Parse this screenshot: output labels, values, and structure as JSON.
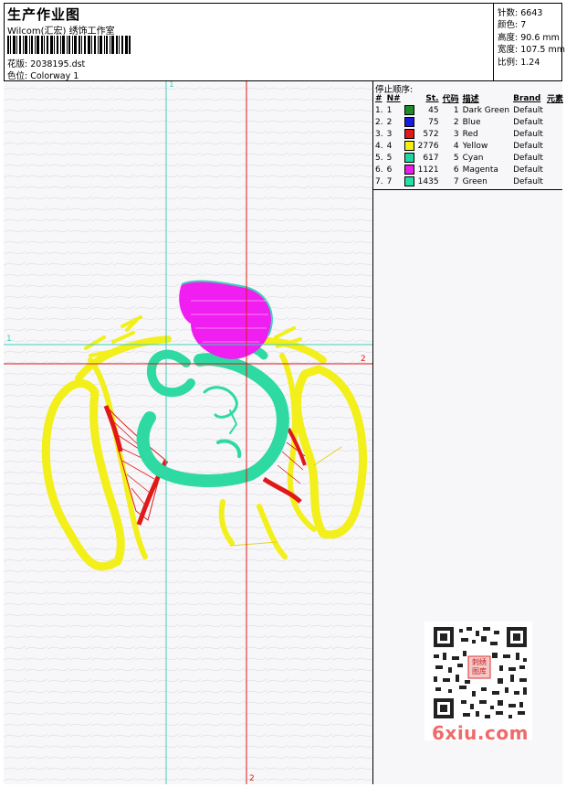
{
  "header": {
    "title": "生产作业图",
    "subtitle": "Wilcom(汇宏) 绣饰工作室",
    "design_label": "花版:",
    "design_value": "2038195.dst",
    "colorway_label": "色位:",
    "colorway_value": "Colorway 1"
  },
  "specs": {
    "stitches_label": "针数:",
    "stitches_value": "6643",
    "colors_label": "颜色:",
    "colors_value": "7",
    "height_label": "高度:",
    "height_value": "90.6 mm",
    "width_label": "宽度:",
    "width_value": "107.5 mm",
    "scale_label": "比例:",
    "scale_value": "1.24"
  },
  "stop_sequence": {
    "title": "停止顺序:",
    "columns": [
      "#",
      "N#",
      "St.",
      "代码",
      "描述",
      "Brand",
      "元素"
    ],
    "rows": [
      {
        "idx": "1.",
        "n": "1",
        "color": "#1e8a2a",
        "st": "45",
        "code": "1",
        "desc": "Dark Green",
        "brand": "Default"
      },
      {
        "idx": "2.",
        "n": "2",
        "color": "#1a1adc",
        "st": "75",
        "code": "2",
        "desc": "Blue",
        "brand": "Default"
      },
      {
        "idx": "3.",
        "n": "3",
        "color": "#e01818",
        "st": "572",
        "code": "3",
        "desc": "Red",
        "brand": "Default"
      },
      {
        "idx": "4.",
        "n": "4",
        "color": "#f5f010",
        "st": "2776",
        "code": "4",
        "desc": "Yellow",
        "brand": "Default"
      },
      {
        "idx": "5.",
        "n": "5",
        "color": "#22d6a0",
        "st": "617",
        "code": "5",
        "desc": "Cyan",
        "brand": "Default"
      },
      {
        "idx": "6.",
        "n": "6",
        "color": "#e81ee8",
        "st": "1121",
        "code": "6",
        "desc": "Magenta",
        "brand": "Default"
      },
      {
        "idx": "7.",
        "n": "7",
        "color": "#22e0a8",
        "st": "1435",
        "code": "7",
        "desc": "Green",
        "brand": "Default"
      }
    ]
  },
  "axes": {
    "v1_label": "1",
    "v2_label": "2",
    "h1_label": "1",
    "h2_label": "2"
  },
  "palette": {
    "yellow": "#f2ef1a",
    "green": "#2ed9a2",
    "magenta": "#f01ef0",
    "red": "#e01818",
    "cyan_line": "#3fd0b8",
    "red_line": "#e01818"
  },
  "watermark": "6xiu.com",
  "qr_stamp": "刺绣图库"
}
